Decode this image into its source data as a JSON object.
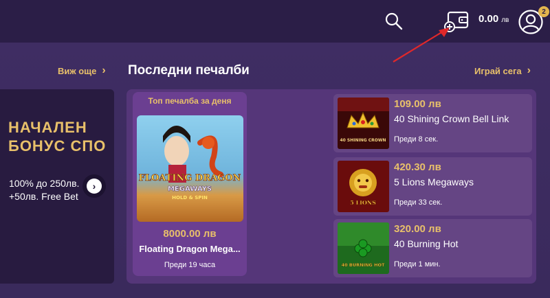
{
  "header": {
    "balance_amount": "0.00",
    "balance_currency": "лв",
    "notification_count": "2"
  },
  "links": {
    "see_more": "Виж още",
    "play_now": "Играй сега"
  },
  "section": {
    "title": "Последни печалби"
  },
  "promo": {
    "title_line1": "НАЧАЛЕН",
    "title_line2": "БОНУС СПО",
    "subtitle_line1": "100% до 250лв.",
    "subtitle_line2": "+50лв. Free Bet"
  },
  "top_win": {
    "label": "Топ печалба за деня",
    "amount": "8000.00 лв",
    "game": "Floating Dragon Mega...",
    "time": "Преди 19 часа",
    "thumb_text_1": "FLOATING DRAGON",
    "thumb_text_2": "MEGAWAYS",
    "thumb_text_3": "HOLD & SPIN"
  },
  "recent_wins": [
    {
      "amount": "109.00 лв",
      "game": "40 Shining Crown Bell Link",
      "time": "Преди 8 сек.",
      "thumb_text": "40 SHINING CROWN"
    },
    {
      "amount": "420.30 лв",
      "game": "5 Lions Megaways",
      "time": "Преди 33 сек.",
      "thumb_text": "5 LIONS"
    },
    {
      "amount": "320.00 лв",
      "game": "40 Burning Hot",
      "time": "Преди 1 мин.",
      "thumb_text": "40 BURNING HOT"
    }
  ],
  "colors": {
    "accent": "#e8c06a",
    "topbar": "#2b1e47",
    "panel": "#553679",
    "row": "#654584",
    "annotation_arrow": "#e0282a"
  }
}
